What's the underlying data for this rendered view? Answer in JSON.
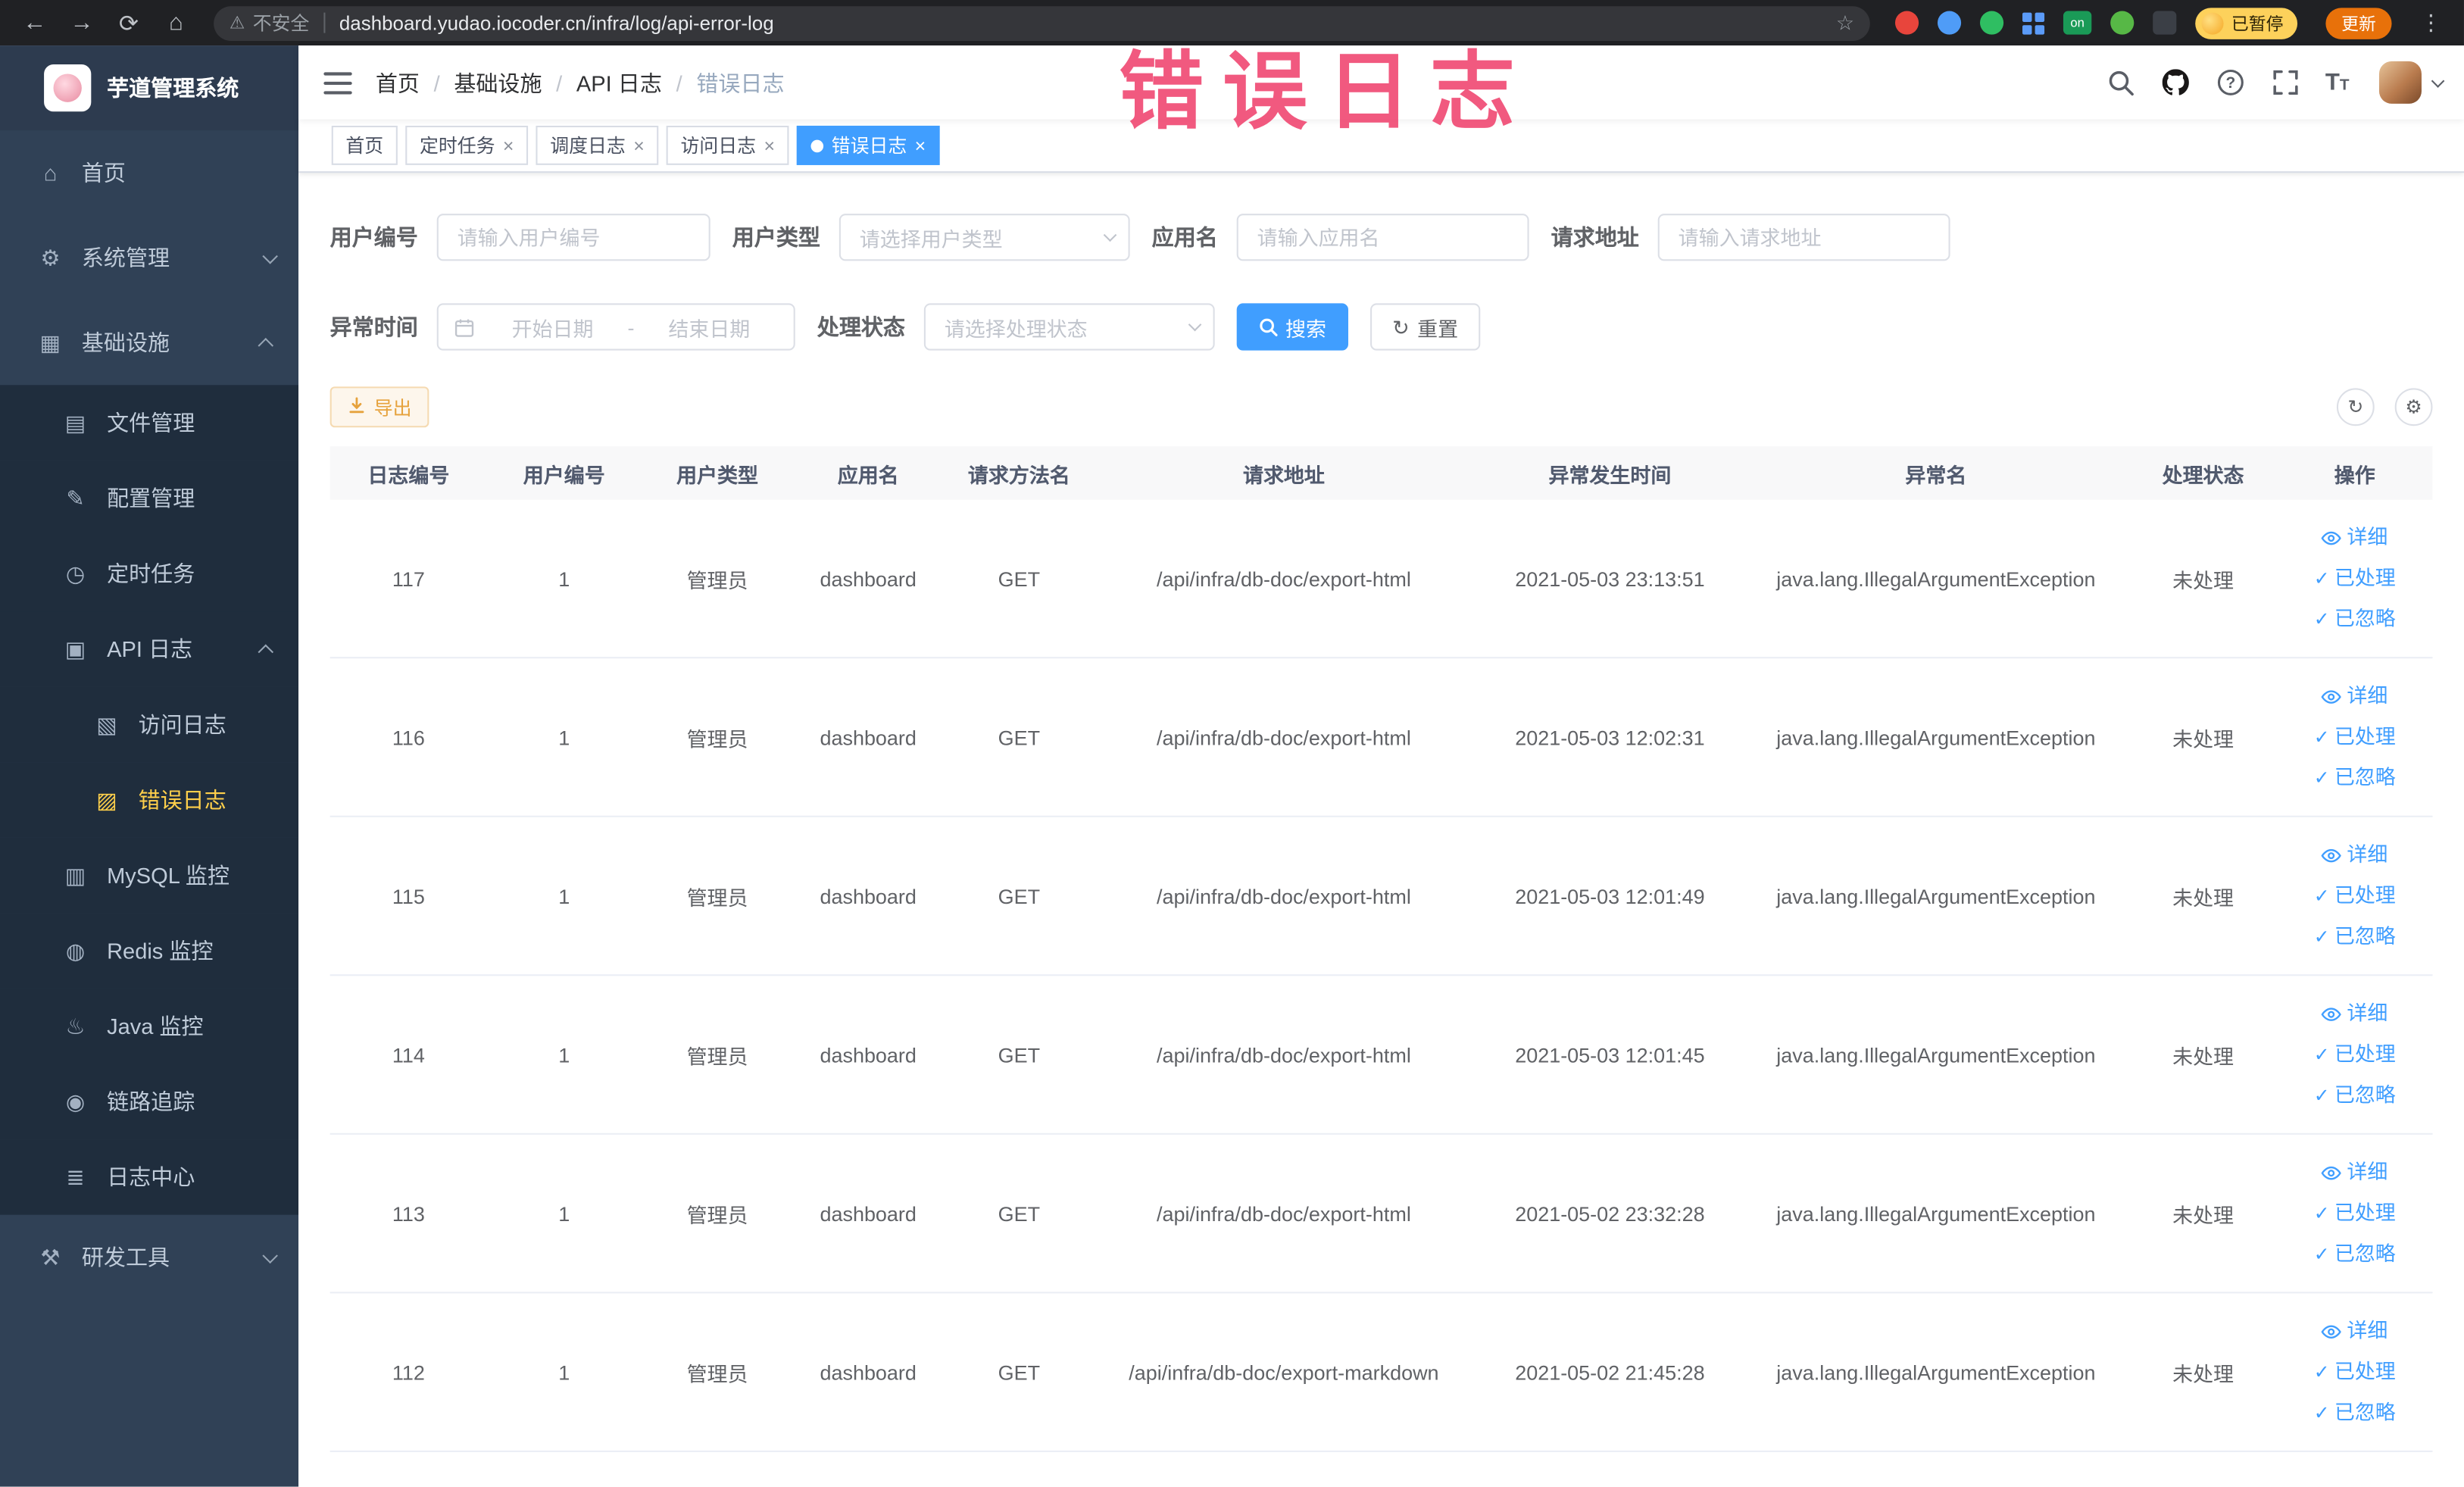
{
  "browser": {
    "security_label": "不安全",
    "url": "dashboard.yudao.iocoder.cn/infra/log/api-error-log",
    "paused_badge": "已暂停",
    "update_button": "更新"
  },
  "watermark": "错误日志",
  "sidebar": {
    "logo_title": "芋道管理系统",
    "items": [
      {
        "label": "首页",
        "icon": "⌂"
      },
      {
        "label": "系统管理",
        "icon": "⚙"
      },
      {
        "label": "基础设施",
        "icon": "▦"
      },
      {
        "label": "文件管理",
        "icon": "▤"
      },
      {
        "label": "配置管理",
        "icon": "✎"
      },
      {
        "label": "定时任务",
        "icon": "◷"
      },
      {
        "label": "API 日志",
        "icon": "▣"
      },
      {
        "label": "访问日志",
        "icon": "▧"
      },
      {
        "label": "错误日志",
        "icon": "▨"
      },
      {
        "label": "MySQL 监控",
        "icon": "▥"
      },
      {
        "label": "Redis 监控",
        "icon": "◍"
      },
      {
        "label": "Java 监控",
        "icon": "♨"
      },
      {
        "label": "链路追踪",
        "icon": "◉"
      },
      {
        "label": "日志中心",
        "icon": "≣"
      },
      {
        "label": "研发工具",
        "icon": "⚒"
      }
    ]
  },
  "header": {
    "breadcrumb": [
      "首页",
      "基础设施",
      "API 日志",
      "错误日志"
    ],
    "breadcrumb_separator": "/"
  },
  "tabs": [
    {
      "label": "首页"
    },
    {
      "label": "定时任务"
    },
    {
      "label": "调度日志"
    },
    {
      "label": "访问日志"
    },
    {
      "label": "错误日志"
    }
  ],
  "filters": {
    "user_id_label": "用户编号",
    "user_id_placeholder": "请输入用户编号",
    "user_type_label": "用户类型",
    "user_type_placeholder": "请选择用户类型",
    "app_name_label": "应用名",
    "app_name_placeholder": "请输入应用名",
    "request_url_label": "请求地址",
    "request_url_placeholder": "请输入请求地址",
    "exception_time_label": "异常时间",
    "date_start_placeholder": "开始日期",
    "date_separator": "-",
    "date_end_placeholder": "结束日期",
    "process_status_label": "处理状态",
    "process_status_placeholder": "请选择处理状态",
    "search_button": "搜索",
    "reset_button": "重置"
  },
  "toolbar": {
    "export_button": "导出"
  },
  "table": {
    "headers": [
      "日志编号",
      "用户编号",
      "用户类型",
      "应用名",
      "请求方法名",
      "请求地址",
      "异常发生时间",
      "异常名",
      "处理状态",
      "操作"
    ],
    "action_detail": "详细",
    "action_processed": "已处理",
    "action_ignored": "已忽略",
    "rows": [
      {
        "id": "117",
        "user_id": "1",
        "user_type": "管理员",
        "app_name": "dashboard",
        "method": "GET",
        "url": "/api/infra/db-doc/export-html",
        "time": "2021-05-03 23:13:51",
        "exception": "java.lang.IllegalArgumentException",
        "status": "未处理"
      },
      {
        "id": "116",
        "user_id": "1",
        "user_type": "管理员",
        "app_name": "dashboard",
        "method": "GET",
        "url": "/api/infra/db-doc/export-html",
        "time": "2021-05-03 12:02:31",
        "exception": "java.lang.IllegalArgumentException",
        "status": "未处理"
      },
      {
        "id": "115",
        "user_id": "1",
        "user_type": "管理员",
        "app_name": "dashboard",
        "method": "GET",
        "url": "/api/infra/db-doc/export-html",
        "time": "2021-05-03 12:01:49",
        "exception": "java.lang.IllegalArgumentException",
        "status": "未处理"
      },
      {
        "id": "114",
        "user_id": "1",
        "user_type": "管理员",
        "app_name": "dashboard",
        "method": "GET",
        "url": "/api/infra/db-doc/export-html",
        "time": "2021-05-03 12:01:45",
        "exception": "java.lang.IllegalArgumentException",
        "status": "未处理"
      },
      {
        "id": "113",
        "user_id": "1",
        "user_type": "管理员",
        "app_name": "dashboard",
        "method": "GET",
        "url": "/api/infra/db-doc/export-html",
        "time": "2021-05-02 23:32:28",
        "exception": "java.lang.IllegalArgumentException",
        "status": "未处理"
      },
      {
        "id": "112",
        "user_id": "1",
        "user_type": "管理员",
        "app_name": "dashboard",
        "method": "GET",
        "url": "/api/infra/db-doc/export-markdown",
        "time": "2021-05-02 21:45:28",
        "exception": "java.lang.IllegalArgumentException",
        "status": "未处理"
      }
    ]
  },
  "colors": {
    "accent": "#409eff",
    "menu_active": "#ffd04b",
    "watermark_pink": "#f0436e",
    "warning": "#e6a23c"
  }
}
